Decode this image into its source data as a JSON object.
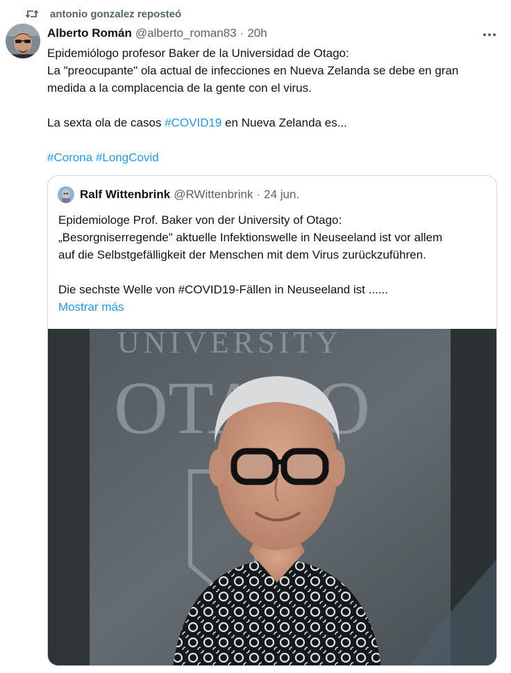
{
  "repost": {
    "label": "antonio gonzalez reposteó",
    "icon": "repost-icon"
  },
  "tweet": {
    "author_name": "Alberto Román",
    "author_handle": "@alberto_roman83",
    "separator": "·",
    "time": "20h",
    "more_icon": "more-icon",
    "lines": {
      "l1": "Epidemiólogo profesor Baker de la Universidad de Otago:",
      "l2": "La \"preocupante\" ola actual de infecciones en Nueva Zelanda se debe en gran",
      "l3": "medida a la complacencia de la gente con el virus.",
      "l4_pre": "La sexta ola de casos ",
      "l4_tag": "#COVID19",
      "l4_post": " en Nueva Zelanda es...",
      "tag1": "#Corona",
      "tag2": "#LongCovid"
    }
  },
  "quote": {
    "author_name": "Ralf Wittenbrink",
    "author_handle": "@RWittenbrink",
    "separator": "·",
    "time": "24 jun.",
    "lines": {
      "l1": "Epidemiologe Prof. Baker von der University of Otago:",
      "l2": "„Besorgniserregende\" aktuelle Infektionswelle in Neuseeland ist vor allem",
      "l3": "auf die Selbstgefälligkeit der Menschen mit dem Virus zurückzuführen.",
      "l4": "Die sechste Welle von #COVID19-Fällen in Neuseeland ist ......",
      "show_more": "Mostrar más"
    },
    "image": {
      "sign_line1": "UNIVERSITY",
      "sign_line2": "OTAGO"
    }
  },
  "colors": {
    "link": "#1d9bf0",
    "secondary": "#536471",
    "text": "#0f1419",
    "border": "#cfd9de"
  }
}
